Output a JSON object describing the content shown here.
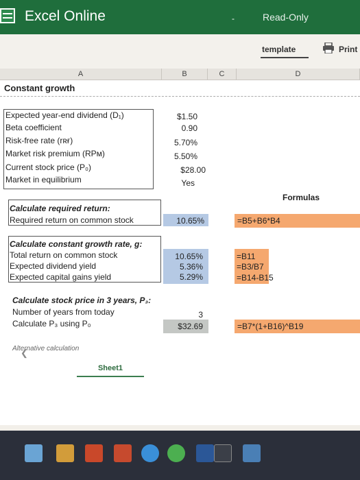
{
  "app": {
    "title": "Excel Online",
    "separator": "-",
    "mode": "Read-Only"
  },
  "toolbar": {
    "template_label": "template",
    "print_label": "Print"
  },
  "columns": [
    "A",
    "B",
    "C",
    "D"
  ],
  "sheet": {
    "heading": "Constant growth",
    "inputs": [
      {
        "label": "Expected year-end dividend (D₁)",
        "value": "$1.50"
      },
      {
        "label": "Beta coefficient",
        "value": "0.90"
      },
      {
        "label": "Risk-free rate (rʀғ)",
        "value": "5.70%"
      },
      {
        "label": "Market risk premium (RPᴍ)",
        "value": "5.50%"
      },
      {
        "label": "Current stock price (P₀)",
        "value": "$28.00"
      },
      {
        "label": "Market in equilibrium",
        "value": "Yes"
      }
    ],
    "formulas_header": "Formulas",
    "required_return": {
      "title": "Calculate required return:",
      "label": "Required return on common stock",
      "value": "10.65%",
      "formula": "=B5+B6*B4"
    },
    "growth": {
      "title": "Calculate constant growth rate, g:",
      "rows": [
        {
          "label": "Total return on common stock",
          "value": "10.65%",
          "formula": "=B11"
        },
        {
          "label": "Expected dividend yield",
          "value": "5.36%",
          "formula": "=B3/B7"
        },
        {
          "label": "Expected capital gains yield",
          "value": "5.29%",
          "formula": "=B14-B15"
        }
      ]
    },
    "price": {
      "title": "Calculate stock price in 3 years, P₃:",
      "rows": [
        {
          "label": "Number of years from today",
          "value": "3",
          "formula": ""
        },
        {
          "label": "Calculate P₃ using P₀",
          "value": "$32.69",
          "formula": "=B7*(1+B16)^B19"
        }
      ]
    },
    "alternative": "Alternative calculation"
  },
  "tabs": {
    "sheet1": "Sheet1"
  },
  "colors": {
    "titlebar": "#1f6e3c",
    "blue_cell": "#b5c9e4",
    "orange_cell": "#f5a86f",
    "taskbar": "#2b2f3a"
  },
  "taskbar_icons": [
    "windows-icon",
    "file-explorer-icon",
    "office-icon",
    "powerpoint-icon",
    "edge-icon",
    "chrome-icon",
    "word-icon",
    "blackboard-icon",
    "photos-icon"
  ]
}
